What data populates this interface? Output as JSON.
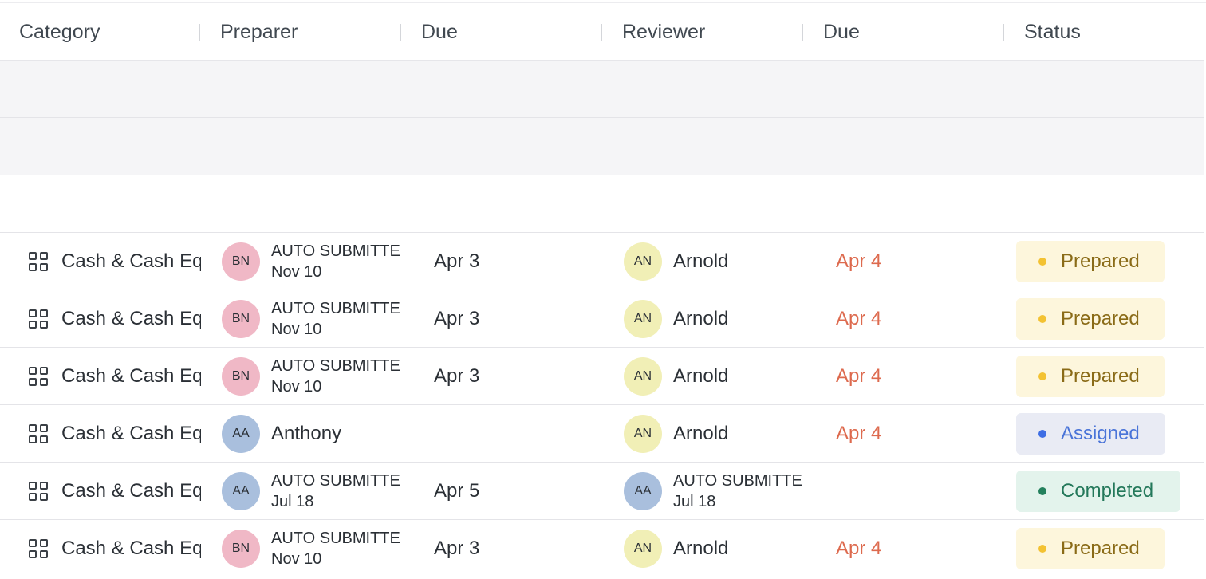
{
  "header": {
    "category": "Category",
    "preparer": "Preparer",
    "preparer_due": "Due",
    "reviewer": "Reviewer",
    "reviewer_due": "Due",
    "status": "Status"
  },
  "colors": {
    "overdue": "#dd6a4e",
    "prepared": "#8a6b17",
    "assigned": "#4a74d8",
    "completed": "#23785a"
  },
  "rows": [
    {
      "category": "Cash & Cash Equivalents",
      "preparer": {
        "initials": "BN",
        "name": "AUTO SUBMITTED",
        "date": "Nov 10"
      },
      "preparer_due": "Apr 3",
      "reviewer": {
        "initials": "AN",
        "name": "Arnold",
        "date": ""
      },
      "reviewer_due": "Apr 4",
      "status": "Prepared"
    },
    {
      "category": "Cash & Cash Equivalents",
      "preparer": {
        "initials": "BN",
        "name": "AUTO SUBMITTED",
        "date": "Nov 10"
      },
      "preparer_due": "Apr 3",
      "reviewer": {
        "initials": "AN",
        "name": "Arnold",
        "date": ""
      },
      "reviewer_due": "Apr 4",
      "status": "Prepared"
    },
    {
      "category": "Cash & Cash Equivalents",
      "preparer": {
        "initials": "BN",
        "name": "AUTO SUBMITTED",
        "date": "Nov 10"
      },
      "preparer_due": "Apr 3",
      "reviewer": {
        "initials": "AN",
        "name": "Arnold",
        "date": ""
      },
      "reviewer_due": "Apr 4",
      "status": "Prepared"
    },
    {
      "category": "Cash & Cash Equivalents",
      "preparer": {
        "initials": "AA",
        "name": "Anthony",
        "date": ""
      },
      "preparer_due": "",
      "reviewer": {
        "initials": "AN",
        "name": "Arnold",
        "date": ""
      },
      "reviewer_due": "Apr 4",
      "status": "Assigned"
    },
    {
      "category": "Cash & Cash Equivalents",
      "preparer": {
        "initials": "AA",
        "name": "AUTO SUBMITTED",
        "date": "Jul 18"
      },
      "preparer_due": "Apr 5",
      "reviewer": {
        "initials": "AA",
        "name": "AUTO SUBMITTED",
        "date": "Jul 18"
      },
      "reviewer_due": "",
      "status": "Completed"
    },
    {
      "category": "Cash & Cash Equivalents",
      "preparer": {
        "initials": "BN",
        "name": "AUTO SUBMITTED",
        "date": "Nov 10"
      },
      "preparer_due": "Apr 3",
      "reviewer": {
        "initials": "AN",
        "name": "Arnold",
        "date": ""
      },
      "reviewer_due": "Apr 4",
      "status": "Prepared"
    }
  ]
}
